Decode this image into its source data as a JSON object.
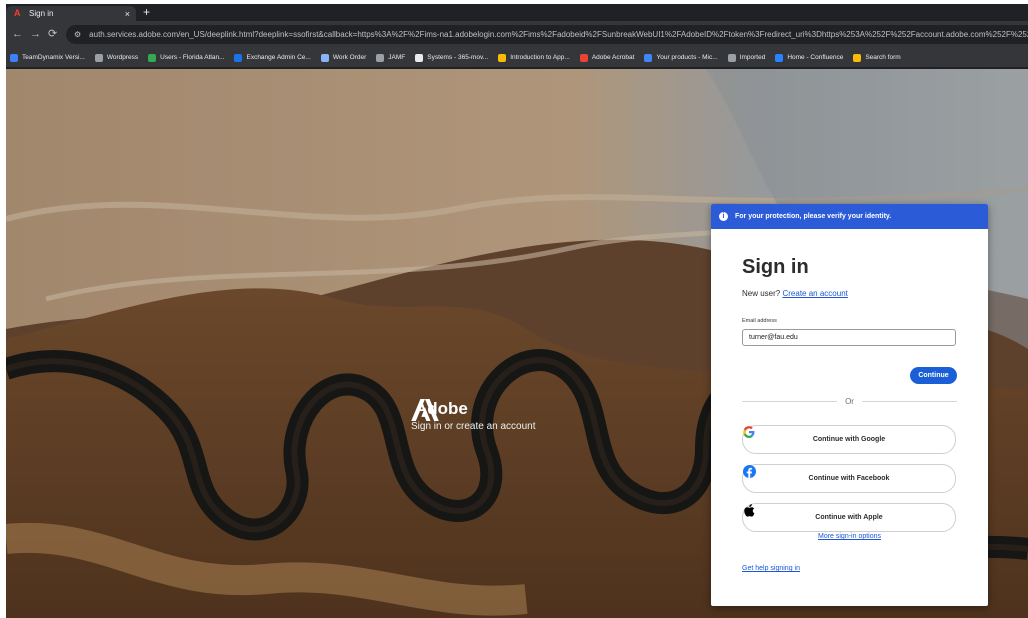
{
  "browser": {
    "tab_title": "Sign in",
    "tab_close": "×",
    "new_tab": "+",
    "url": "auth.services.adobe.com/en_US/deeplink.html?deeplink=ssofirst&callback=https%3A%2F%2Fims-na1.adobelogin.com%2Fims%2Fadobeid%2FSunbreakWebUI1%2FAdobeID%2Ftoken%3Fredirect_uri%3Dhttps%253A%252F%252Faccount.adobe.com%252F%2523old_hash%253D%2"
  },
  "bookmarks": [
    {
      "label": "TeamDynamix Versi...",
      "icon": "teamdynamix-icon",
      "color": "#3b82f6"
    },
    {
      "label": "Wordpress",
      "icon": "wordpress-icon",
      "color": "#9aa0a6"
    },
    {
      "label": "Users - Florida Atlan...",
      "icon": "users-icon",
      "color": "#34a853"
    },
    {
      "label": "Exchange Admin Ce...",
      "icon": "exchange-icon",
      "color": "#1a73e8"
    },
    {
      "label": "Work Order",
      "icon": "work-order-icon",
      "color": "#8ab4f8"
    },
    {
      "label": "JAMF",
      "icon": "jamf-icon",
      "color": "#9aa0a6"
    },
    {
      "label": "Systems - 365-mov...",
      "icon": "systems-icon",
      "color": "#e8eaed"
    },
    {
      "label": "Introduction to App...",
      "icon": "intro-icon",
      "color": "#fbbc04"
    },
    {
      "label": "Adobe Acrobat",
      "icon": "acrobat-icon",
      "color": "#ea4335"
    },
    {
      "label": "Your products - Mic...",
      "icon": "microsoft-icon",
      "color": "#4285f4"
    },
    {
      "label": "Imported",
      "icon": "folder-icon",
      "color": "#9aa0a6"
    },
    {
      "label": "Home - Confluence",
      "icon": "confluence-icon",
      "color": "#2684ff"
    },
    {
      "label": "Search form",
      "icon": "search-form-icon",
      "color": "#fbbc04"
    }
  ],
  "brand": {
    "name": "Adobe",
    "tagline": "Sign in or create an account"
  },
  "signin": {
    "banner": "For your protection, please verify your identity.",
    "heading": "Sign in",
    "new_user_text": "New user?",
    "create_account": "Create an account",
    "email_label": "Email address",
    "email_value": "turner@fau.edu",
    "continue": "Continue",
    "or": "Or",
    "google": "Continue with Google",
    "facebook": "Continue with Facebook",
    "apple": "Continue with Apple",
    "more_options": "More sign-in options",
    "help": "Get help signing in"
  },
  "colors": {
    "banner": "#2c5bd8",
    "primary_button": "#1a5fd6",
    "link": "#1a56d6"
  }
}
